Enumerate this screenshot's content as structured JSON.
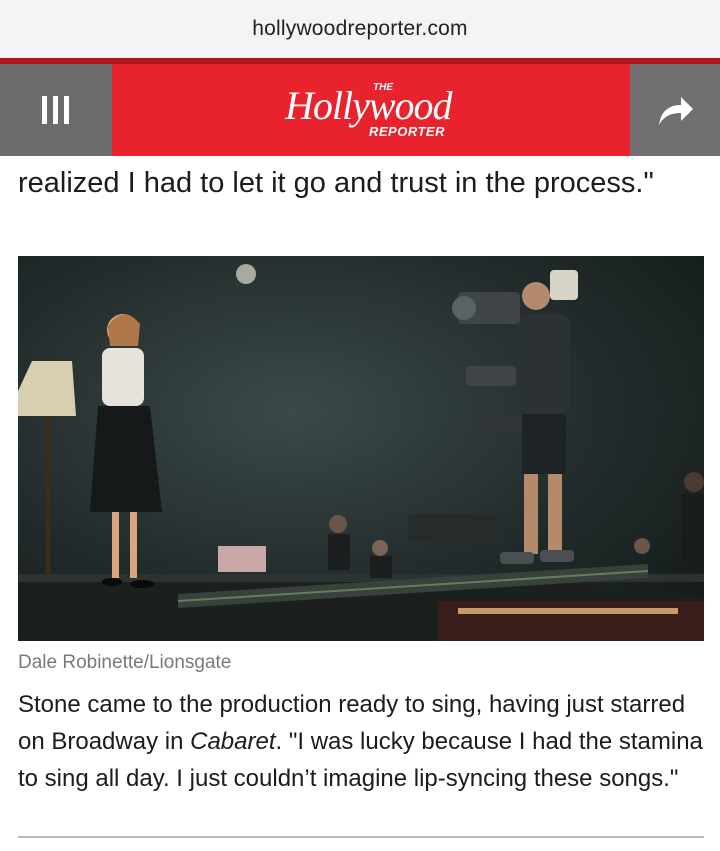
{
  "browser": {
    "url": "hollywoodreporter.com"
  },
  "header": {
    "menu_icon": "hamburger-menu-icon",
    "share_icon": "share-arrow-icon",
    "logo_the": "THE",
    "logo_main": "Hollywood",
    "logo_reporter": "REPORTER",
    "brand_color": "#e8232d"
  },
  "article": {
    "lead_text": "realized I had to let it go and trust in the process.\"",
    "photo_credit": "Dale Robinette/Lionsgate",
    "paragraph": {
      "before": "Stone came to the production ready to sing, having just starred on Broadway in ",
      "italic": "Cabaret",
      "after": ". \"I was lucky because I had the stamina to sing all day. I just couldn’t imagine lip-syncing these songs.\""
    }
  }
}
